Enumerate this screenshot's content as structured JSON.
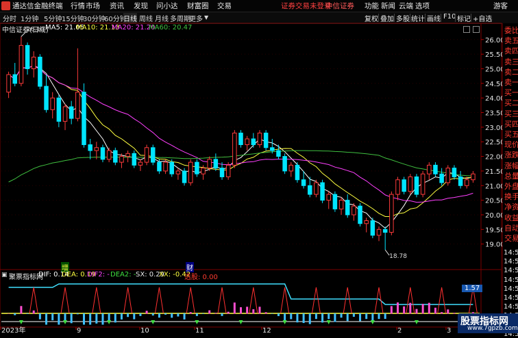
{
  "app": {
    "title": "通达信金融终端"
  },
  "menu": [
    "行情",
    "市场",
    "资讯",
    "发现",
    "问小达",
    "财富圈",
    "交易"
  ],
  "login_warning": "证券交易未登录",
  "broker": "中信证券",
  "top_right": [
    "功能",
    "新闻",
    "云端",
    "选项",
    "游客"
  ],
  "periods": [
    "分时",
    "1分钟",
    "5分钟",
    "15分钟",
    "30分钟",
    "60分钟",
    "日线",
    "周线",
    "月线",
    "多周期",
    "更多"
  ],
  "active_period": "日线",
  "toolbar_right": [
    "复权",
    "叠加",
    "多股",
    "统计",
    "画线",
    "F10",
    "标记",
    "+自选"
  ],
  "security_label": "中信证券(日线)",
  "ma": {
    "ma5": "MA5: 21.05",
    "ma10": "MA10: 21.13",
    "ma20": "MA20: 21.20",
    "ma60": "MA60: 20.47"
  },
  "y_ticks": [
    "26.00",
    "25.50",
    "25.00",
    "24.50",
    "24.00",
    "23.50",
    "23.00",
    "22.50",
    "22.00",
    "21.50",
    "21.00",
    "20.50",
    "20.00",
    "19.50",
    "19.00"
  ],
  "price_labels": {
    "high": "26.10",
    "low": "18.78"
  },
  "event_marks": {
    "notice1": "增",
    "notice2": "财"
  },
  "indicator": {
    "name": "聚票指标网",
    "dif": "DIF: 0.14",
    "dea": "DEA: 0.19",
    "dif2": "DIF2: -",
    "dea2": "DEA2: -",
    "sx": "SX: 0.29",
    "xx": "XX: -0.42",
    "signal": "选股: 0.00",
    "value_tag": "1.57"
  },
  "x_ticks": [
    "2023年",
    "9",
    "10",
    "11",
    "12",
    "2",
    "3"
  ],
  "side_labels": [
    "委比",
    "卖五",
    "卖四",
    "卖三",
    "卖二",
    "卖一",
    "买一",
    "买二",
    "买三",
    "买四",
    "买五",
    "现价",
    "涨跌",
    "涨幅",
    "总量",
    "外盘",
    "换手",
    "净资",
    "收益",
    "自动",
    "交易"
  ],
  "side_times": [
    "14:50",
    "14:50",
    "14:50",
    "14:50",
    "14:50",
    "14:50",
    "14:50",
    "14:50",
    "14:50",
    "14:50"
  ],
  "watermark": {
    "title": "股票指标网",
    "url": "www.7gpzb.com"
  },
  "chart_data": {
    "type": "candlestick",
    "title": "中信证券(日线)",
    "ylim": [
      18.5,
      26.3
    ],
    "x_ticks": [
      "2023年",
      "9",
      "10",
      "11",
      "12",
      "2",
      "3"
    ],
    "candles": [
      [
        24.2,
        24.9,
        24.0,
        24.8
      ],
      [
        24.8,
        25.2,
        24.4,
        24.5
      ],
      [
        24.5,
        26.1,
        24.4,
        25.8
      ],
      [
        25.8,
        25.9,
        24.8,
        25.0
      ],
      [
        25.0,
        25.6,
        24.7,
        25.4
      ],
      [
        25.4,
        25.5,
        24.3,
        24.4
      ],
      [
        24.4,
        24.8,
        23.5,
        23.6
      ],
      [
        23.6,
        24.2,
        23.3,
        24.0
      ],
      [
        24.0,
        24.1,
        23.0,
        23.2
      ],
      [
        23.2,
        23.8,
        22.9,
        23.7
      ],
      [
        23.7,
        23.9,
        23.1,
        23.3
      ],
      [
        23.3,
        25.7,
        23.2,
        24.2
      ],
      [
        24.2,
        24.5,
        22.3,
        22.4
      ],
      [
        22.4,
        22.6,
        21.9,
        22.2
      ],
      [
        22.2,
        22.5,
        21.9,
        22.3
      ],
      [
        22.3,
        22.4,
        21.8,
        21.9
      ],
      [
        21.9,
        22.3,
        21.8,
        22.2
      ],
      [
        22.2,
        22.3,
        21.7,
        21.8
      ],
      [
        21.8,
        22.1,
        21.6,
        22.0
      ],
      [
        22.0,
        22.2,
        21.8,
        22.1
      ],
      [
        22.1,
        22.2,
        21.6,
        21.7
      ],
      [
        21.7,
        21.9,
        21.5,
        21.8
      ],
      [
        21.8,
        22.4,
        21.7,
        22.3
      ],
      [
        22.3,
        22.4,
        21.7,
        21.8
      ],
      [
        21.8,
        21.9,
        21.4,
        21.5
      ],
      [
        21.5,
        21.9,
        21.4,
        21.8
      ],
      [
        21.8,
        21.9,
        21.3,
        21.4
      ],
      [
        21.4,
        21.6,
        21.2,
        21.5
      ],
      [
        21.5,
        21.6,
        21.0,
        21.1
      ],
      [
        21.1,
        21.9,
        21.0,
        21.8
      ],
      [
        21.8,
        21.9,
        21.3,
        21.4
      ],
      [
        21.4,
        21.7,
        21.2,
        21.6
      ],
      [
        21.6,
        22.0,
        21.5,
        21.9
      ],
      [
        21.9,
        22.1,
        21.5,
        21.6
      ],
      [
        21.6,
        21.8,
        21.2,
        21.3
      ],
      [
        21.3,
        21.8,
        21.2,
        21.7
      ],
      [
        21.7,
        22.9,
        21.6,
        22.8
      ],
      [
        22.8,
        22.9,
        22.3,
        22.4
      ],
      [
        22.4,
        22.7,
        22.2,
        22.6
      ],
      [
        22.6,
        22.8,
        22.3,
        22.4
      ],
      [
        22.4,
        22.9,
        22.3,
        22.8
      ],
      [
        22.8,
        22.9,
        22.2,
        22.3
      ],
      [
        22.3,
        22.6,
        22.1,
        22.2
      ],
      [
        22.2,
        22.4,
        21.9,
        22.0
      ],
      [
        22.0,
        22.1,
        21.4,
        21.5
      ],
      [
        21.5,
        21.8,
        21.3,
        21.7
      ],
      [
        21.7,
        21.8,
        21.1,
        21.2
      ],
      [
        21.2,
        21.5,
        20.9,
        21.0
      ],
      [
        21.0,
        21.3,
        20.6,
        20.7
      ],
      [
        20.7,
        21.2,
        20.6,
        21.1
      ],
      [
        21.1,
        21.2,
        20.4,
        20.5
      ],
      [
        20.5,
        20.8,
        20.2,
        20.7
      ],
      [
        20.7,
        20.8,
        20.1,
        20.2
      ],
      [
        20.2,
        20.6,
        20.0,
        20.5
      ],
      [
        20.5,
        20.7,
        19.9,
        20.0
      ],
      [
        20.0,
        20.4,
        19.8,
        20.3
      ],
      [
        20.3,
        20.4,
        19.6,
        19.7
      ],
      [
        19.7,
        19.9,
        19.4,
        19.8
      ],
      [
        19.8,
        19.9,
        19.2,
        19.3
      ],
      [
        19.3,
        19.6,
        19.1,
        19.5
      ],
      [
        19.5,
        19.6,
        18.8,
        19.4
      ],
      [
        19.4,
        20.8,
        19.3,
        20.7
      ],
      [
        20.7,
        21.3,
        20.5,
        21.2
      ],
      [
        21.2,
        21.3,
        20.7,
        20.8
      ],
      [
        20.8,
        21.4,
        20.7,
        21.3
      ],
      [
        21.3,
        21.4,
        20.6,
        20.7
      ],
      [
        20.7,
        21.5,
        20.6,
        21.4
      ],
      [
        21.4,
        21.8,
        21.2,
        21.7
      ],
      [
        21.7,
        21.8,
        21.3,
        21.4
      ],
      [
        21.4,
        21.6,
        21.0,
        21.1
      ],
      [
        21.1,
        21.7,
        21.0,
        21.6
      ],
      [
        21.6,
        21.7,
        21.2,
        21.3
      ],
      [
        21.3,
        21.5,
        20.9,
        21.0
      ],
      [
        21.0,
        21.3,
        20.9,
        21.2
      ],
      [
        21.2,
        21.5,
        21.1,
        21.4
      ]
    ],
    "ma_colors": {
      "ma5": "#ffffff",
      "ma10": "#ffff40",
      "ma20": "#ff40ff",
      "ma60": "#40c040"
    }
  },
  "colors": {
    "up": "#ff3b3b",
    "down": "#00e5ff",
    "bg": "#000000",
    "grid_red": "#7a0000"
  }
}
